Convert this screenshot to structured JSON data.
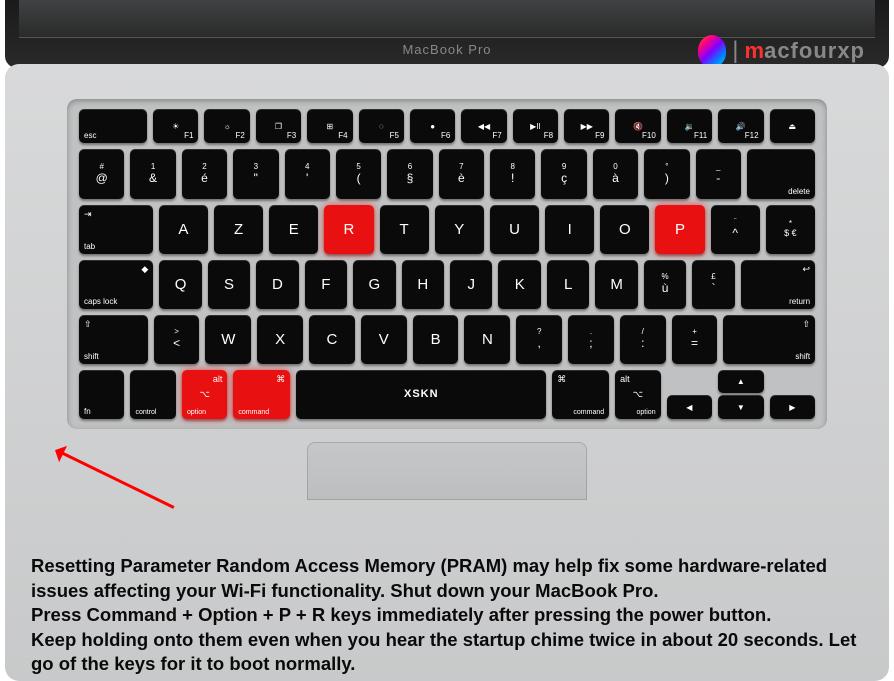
{
  "laptop": {
    "model": "MacBook Pro"
  },
  "logo": {
    "brand_initial": "m",
    "brand_rest": "acfourxp"
  },
  "keyboard": {
    "row_fn": [
      {
        "label": "esc"
      },
      {
        "label": "F1",
        "icon": "☀"
      },
      {
        "label": "F2",
        "icon": "☼"
      },
      {
        "label": "F3",
        "icon": "❐"
      },
      {
        "label": "F4",
        "icon": "⊞"
      },
      {
        "label": "F5",
        "icon": "◌"
      },
      {
        "label": "F6",
        "icon": "●"
      },
      {
        "label": "F7",
        "icon": "◀◀"
      },
      {
        "label": "F8",
        "icon": "▶II"
      },
      {
        "label": "F9",
        "icon": "▶▶"
      },
      {
        "label": "F10",
        "icon": "🔇"
      },
      {
        "label": "F11",
        "icon": "🔉"
      },
      {
        "label": "F12",
        "icon": "🔊"
      },
      {
        "label": "⏏"
      }
    ],
    "row_num": [
      {
        "top": "#",
        "bot": "@"
      },
      {
        "top": "1",
        "bot": "&"
      },
      {
        "top": "2",
        "bot": "é"
      },
      {
        "top": "3",
        "bot": "\""
      },
      {
        "top": "4",
        "bot": "'"
      },
      {
        "top": "5",
        "bot": "("
      },
      {
        "top": "6",
        "bot": "§"
      },
      {
        "top": "7",
        "bot": "è"
      },
      {
        "top": "8",
        "bot": "!"
      },
      {
        "top": "9",
        "bot": "ç"
      },
      {
        "top": "0",
        "bot": "à"
      },
      {
        "top": "°",
        "bot": ")"
      },
      {
        "top": "_",
        "bot": "-"
      },
      {
        "label": "delete"
      }
    ],
    "row_q": [
      {
        "label": "tab",
        "icon": "⇥"
      },
      {
        "letter": "A"
      },
      {
        "letter": "Z"
      },
      {
        "letter": "E"
      },
      {
        "letter": "R",
        "hl": true
      },
      {
        "letter": "T"
      },
      {
        "letter": "Y"
      },
      {
        "letter": "U"
      },
      {
        "letter": "I"
      },
      {
        "letter": "O"
      },
      {
        "letter": "P",
        "hl": true
      },
      {
        "top": "¨",
        "bot": "^"
      },
      {
        "top": "*",
        "bot": "$ €"
      }
    ],
    "row_a": [
      {
        "label": "caps lock",
        "icon": "◆"
      },
      {
        "letter": "Q"
      },
      {
        "letter": "S"
      },
      {
        "letter": "D"
      },
      {
        "letter": "F"
      },
      {
        "letter": "G"
      },
      {
        "letter": "H"
      },
      {
        "letter": "J"
      },
      {
        "letter": "K"
      },
      {
        "letter": "L"
      },
      {
        "letter": "M"
      },
      {
        "top": "%",
        "bot": "ù"
      },
      {
        "top": "£",
        "bot": "`"
      },
      {
        "label": "return",
        "icon": "↩"
      }
    ],
    "row_z": [
      {
        "label": "shift",
        "icon": "⇧"
      },
      {
        "top": ">",
        "bot": "<"
      },
      {
        "letter": "W"
      },
      {
        "letter": "X"
      },
      {
        "letter": "C"
      },
      {
        "letter": "V"
      },
      {
        "letter": "B"
      },
      {
        "letter": "N"
      },
      {
        "top": "?",
        "bot": ","
      },
      {
        "top": ".",
        "bot": ";"
      },
      {
        "top": "/",
        "bot": ":"
      },
      {
        "top": "+",
        "bot": "="
      },
      {
        "label": "shift",
        "icon": "⇧"
      }
    ],
    "row_mod": {
      "fn": "fn",
      "control": "control",
      "option_l": "option",
      "option_alt": "alt",
      "option_sym": "⌥",
      "command_l": "command",
      "command_sym": "⌘",
      "space_brand": "XSKN",
      "command_r": "command",
      "option_r": "option",
      "arrows": {
        "left": "◀",
        "up": "▲",
        "down": "▼",
        "right": "▶"
      }
    }
  },
  "instructions": {
    "line1": "Resetting Parameter Random Access Memory (PRAM) may help fix some hardware-related issues affecting your Wi-Fi functionality. Shut down your MacBook Pro.",
    "line2": "Press Command + Option + P + R keys immediately after pressing the power button.",
    "line3": "Keep holding onto them even when you hear the startup chime twice in about 20 seconds. Let go of the keys for it to boot normally."
  }
}
